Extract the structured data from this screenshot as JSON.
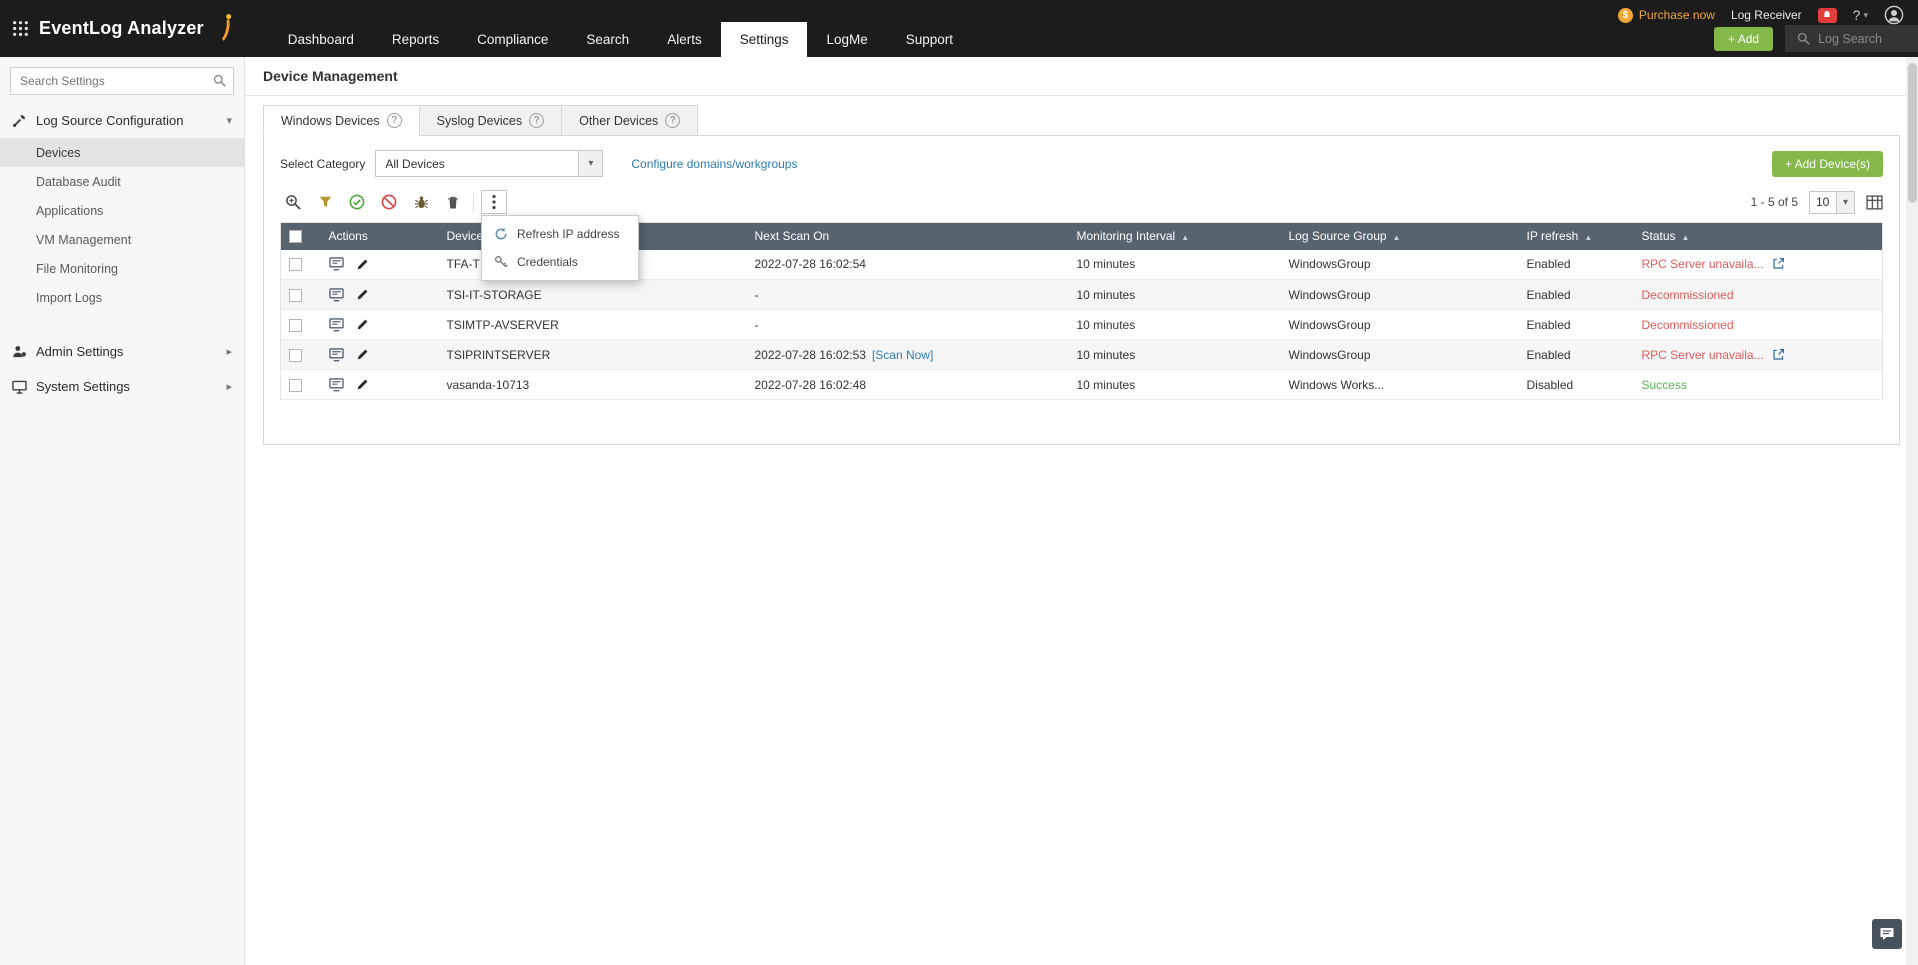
{
  "header": {
    "app_title": "EventLog Analyzer",
    "nav": [
      "Dashboard",
      "Reports",
      "Compliance",
      "Search",
      "Alerts",
      "Settings",
      "LogMe",
      "Support"
    ],
    "purchase_now": "Purchase now",
    "log_receiver": "Log Receiver",
    "help_label": "?",
    "add_button": "+ Add",
    "log_search": "Log Search"
  },
  "sidebar": {
    "search_placeholder": "Search Settings",
    "log_source_section": "Log Source Configuration",
    "items": [
      "Devices",
      "Database Audit",
      "Applications",
      "VM Management",
      "File Monitoring",
      "Import Logs"
    ],
    "selected_item": "Devices",
    "admin_settings": "Admin Settings",
    "system_settings": "System Settings"
  },
  "main": {
    "page_title": "Device Management",
    "tabs": [
      "Windows Devices",
      "Syslog Devices",
      "Other Devices"
    ],
    "active_tab": "Windows Devices",
    "select_category_label": "Select Category",
    "category_value": "All Devices",
    "configure_link": "Configure domains/workgroups",
    "add_devices_button": "+ Add Device(s)",
    "pagination": {
      "range": "1 - 5 of 5",
      "page_size": "10"
    },
    "context_menu": {
      "items": [
        "Refresh IP address",
        "Credentials"
      ]
    },
    "table": {
      "columns": {
        "actions": "Actions",
        "device": "Device",
        "next_scan": "Next Scan On",
        "interval": "Monitoring Interval",
        "group": "Log Source Group",
        "ip_refresh": "IP refresh",
        "status": "Status"
      },
      "rows": [
        {
          "device": "TFA-T",
          "next_scan": "2022-07-28 16:02:54",
          "interval": "10 minutes",
          "group": "WindowsGroup",
          "ip_refresh": "Enabled",
          "status": "RPC Server unavaila..."
        },
        {
          "device": "TSI-IT-STORAGE",
          "next_scan": "-",
          "interval": "10 minutes",
          "group": "WindowsGroup",
          "ip_refresh": "Enabled",
          "status": "Decommissioned"
        },
        {
          "device": "TSIMTP-AVSERVER",
          "next_scan": "-",
          "interval": "10 minutes",
          "group": "WindowsGroup",
          "ip_refresh": "Enabled",
          "status": "Decommissioned"
        },
        {
          "device": "TSIPRINTSERVER",
          "next_scan": "2022-07-28 16:02:53",
          "scan_now": "[Scan Now]",
          "interval": "10 minutes",
          "group": "WindowsGroup",
          "ip_refresh": "Enabled",
          "status": "RPC Server unavaila..."
        },
        {
          "device": "vasanda-10713",
          "next_scan": "2022-07-28 16:02:48",
          "interval": "10 minutes",
          "group": "Windows Works...",
          "ip_refresh": "Disabled",
          "status": "Success"
        }
      ]
    }
  }
}
